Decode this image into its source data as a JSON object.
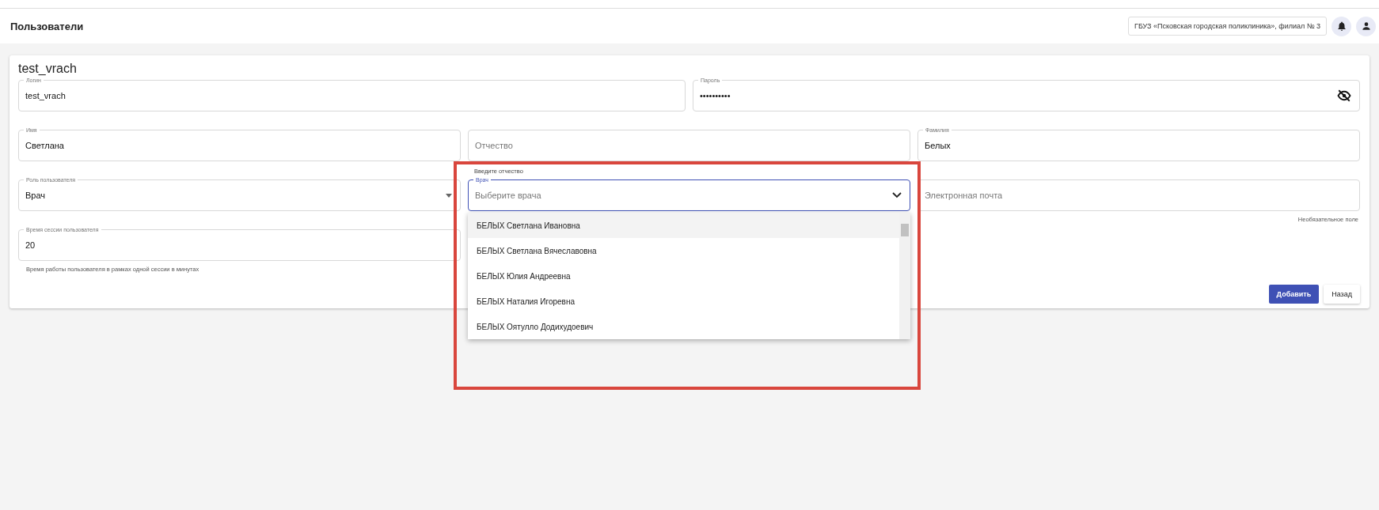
{
  "header": {
    "title": "Пользователи",
    "organization": "ГБУЗ «Псковская городская поликлиника», филиал № 3"
  },
  "form": {
    "title": "test_vrach",
    "rows": [
      [
        {
          "kind": "text",
          "label": "Логин",
          "value": "test_vrach"
        },
        {
          "kind": "password",
          "label": "Пароль",
          "value": "••••••••••"
        }
      ],
      [
        {
          "kind": "text",
          "label": "Имя",
          "value": "Светлана"
        },
        {
          "kind": "text",
          "placeholder": "Отчество",
          "hint": "Введите отчество"
        },
        {
          "kind": "text",
          "label": "Фамилия",
          "value": "Белых"
        }
      ],
      [
        {
          "kind": "select",
          "label": "Роль пользователя",
          "value": "Врач"
        },
        {
          "kind": "combo",
          "label": "Врач",
          "placeholder": "Выберите врача",
          "focused": true,
          "expanded": true
        },
        {
          "kind": "text",
          "placeholder": "Электронная почта",
          "helper": "Необязательное поле"
        }
      ],
      [
        {
          "kind": "text",
          "label": "Время сессии пользователя",
          "value": "20",
          "helper": "Время работы пользователя в рамках одной сессии в минутах"
        }
      ]
    ],
    "options": [
      {
        "label": "БЕЛЫХ Светлана Ивановна",
        "selected": true
      },
      {
        "label": "БЕЛЫХ Светлана Вячеславовна",
        "selected": false
      },
      {
        "label": "БЕЛЫХ Юлия Андреевна",
        "selected": false
      },
      {
        "label": "БЕЛЫХ Наталия Игоревна",
        "selected": false
      },
      {
        "label": "БЕЛЫХ Оятулло Додихудоевич",
        "selected": false
      }
    ],
    "buttons": [
      {
        "label": "Добавить",
        "kind": "primary"
      },
      {
        "label": "Назад",
        "kind": "secondary"
      }
    ]
  },
  "annotation": {
    "kind": "highlight-frame"
  }
}
